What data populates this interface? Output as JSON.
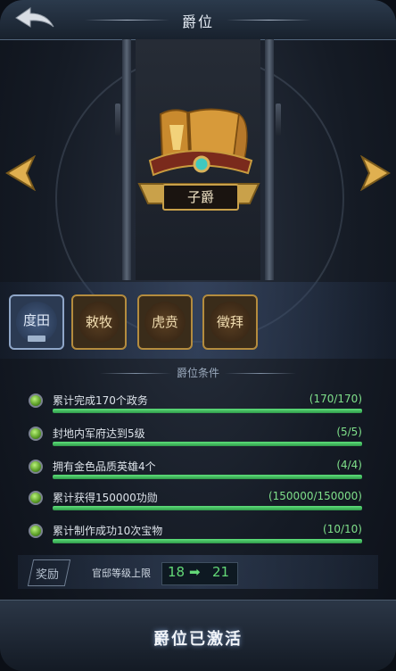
{
  "header": {
    "title": "爵位"
  },
  "rank_display": {
    "name": "子爵"
  },
  "rank_tabs": [
    {
      "label": "度田",
      "state": "active"
    },
    {
      "label": "敕牧",
      "state": "locked"
    },
    {
      "label": "虎贲",
      "state": "locked"
    },
    {
      "label": "徵拜",
      "state": "locked"
    }
  ],
  "conditions": {
    "header": "爵位条件",
    "items": [
      {
        "text": "累计完成170个政务",
        "value": "(170/170)",
        "progress": 1.0
      },
      {
        "text": "封地内军府达到5级",
        "value": "(5/5)",
        "progress": 1.0
      },
      {
        "text": "拥有金色品质英雄4个",
        "value": "(4/4)",
        "progress": 1.0
      },
      {
        "text": "累计获得150000功勋",
        "value": "(150000/150000)",
        "progress": 1.0
      },
      {
        "text": "累计制作成功10次宝物",
        "value": "(10/10)",
        "progress": 1.0
      }
    ]
  },
  "reward": {
    "label": "奖励",
    "description": "官邸等级上限",
    "from": "18",
    "arrow": "➡",
    "to": "21"
  },
  "footer": {
    "status": "爵位已激活"
  },
  "colors": {
    "progress": "#4cc96a",
    "accent_gold": "#c9a14a",
    "value_green": "#7fe08a"
  }
}
